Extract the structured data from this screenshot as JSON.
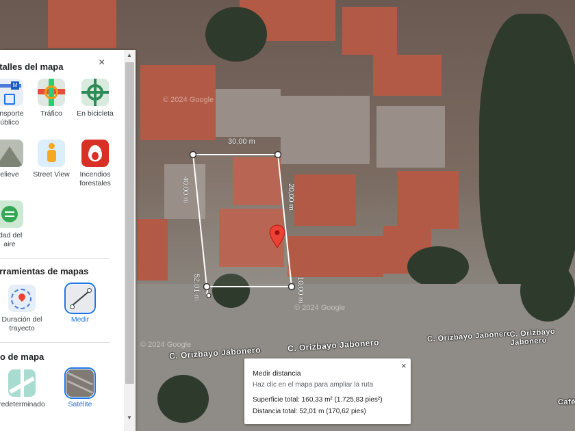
{
  "panel": {
    "map_details_title": "etalles del mapa",
    "close_label": "×",
    "details_items": [
      {
        "label": "ansporte\núblico",
        "icon": "transit-icon"
      },
      {
        "label": "Tráfico",
        "icon": "traffic-icon"
      },
      {
        "label": "En bicicleta",
        "icon": "bicycle-icon"
      },
      {
        "label": "elieve",
        "icon": "terrain-icon"
      },
      {
        "label": "Street View",
        "icon": "street-view-icon"
      },
      {
        "label": "Incendios\nforestales",
        "icon": "wildfire-icon"
      },
      {
        "label": "idad del\naire",
        "icon": "air-quality-icon"
      }
    ],
    "tools_title": "erramientas de mapas",
    "tools_items": [
      {
        "label": "Duración del\ntrayecto",
        "icon": "travel-time-icon"
      },
      {
        "label": "Medir",
        "icon": "measure-icon"
      }
    ],
    "map_type_title": "po de mapa",
    "map_type_items": [
      {
        "label": "redeterminado",
        "icon": "default-map-icon"
      },
      {
        "label": "Satélite",
        "icon": "satellite-icon"
      }
    ]
  },
  "map": {
    "streets": [
      "C. Orizbayo Jabonero",
      "C. Orizbayo Jabonero",
      "C. Orizbayo Jabonero",
      "C. Orizbayo Jabonero"
    ],
    "edge_label": "Café",
    "watermark": "© 2024 Google",
    "dimensions": {
      "top": "30,00 m",
      "left": "40,00 m",
      "right": "20,00 m",
      "bottom_left": "52,01 m",
      "bottom_right": "10,00 m"
    }
  },
  "measure_popup": {
    "title": "Medir distancia",
    "hint": "Haz clic en el mapa para ampliar la ruta",
    "area": "Superficie total: 160,33 m² (1.725,83 pies²)",
    "distance": "Distancia total: 52,01 m (170,62 pies)",
    "close_label": "×"
  },
  "colors": {
    "accent": "#1a73e8",
    "pin": "#ea4335"
  }
}
